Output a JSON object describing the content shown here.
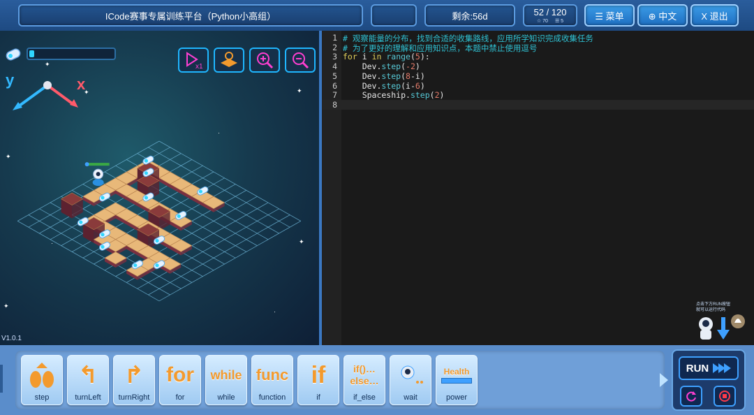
{
  "header": {
    "title": "ICode赛事专属训练平台（Python小高组）",
    "blank_box": "",
    "remaining": "剩余:56d",
    "progress": {
      "main": "52 / 120",
      "sub_left": "☆ 70",
      "sub_right": "☰ 5"
    },
    "menu_label": "☰ 菜单",
    "lang_label": "⊕ 中文",
    "exit_label": "X 退出"
  },
  "game": {
    "energy_level": 0.06,
    "axis_y": "y",
    "axis_x": "x",
    "version": "V1.0.1",
    "tools": [
      "speed-x1-icon",
      "map-icon",
      "zoom-in-icon",
      "zoom-out-icon"
    ],
    "helper_text_1": "点击下方RUN按钮",
    "helper_text_2": "就可以运行代码"
  },
  "editor": {
    "lines": [
      {
        "n": "1",
        "segments": [
          {
            "t": "# 观察能量的分布，找到合适的收集路线，应用所学知识完成收集任务",
            "c": "cm"
          }
        ]
      },
      {
        "n": "2",
        "segments": [
          {
            "t": "# 为了更好的理解和应用知识点，本题中禁止使用逗号",
            "c": "cm"
          }
        ]
      },
      {
        "n": "3",
        "segments": [
          {
            "t": "for",
            "c": "kw"
          },
          {
            "t": " i ",
            "c": ""
          },
          {
            "t": "in",
            "c": "kw"
          },
          {
            "t": " ",
            "c": ""
          },
          {
            "t": "range",
            "c": "fn"
          },
          {
            "t": "(",
            "c": ""
          },
          {
            "t": "5",
            "c": "num"
          },
          {
            "t": "):",
            "c": ""
          }
        ]
      },
      {
        "n": "4",
        "segments": [
          {
            "t": "    Dev.",
            "c": ""
          },
          {
            "t": "step",
            "c": "fn"
          },
          {
            "t": "(",
            "c": ""
          },
          {
            "t": "-2",
            "c": "num"
          },
          {
            "t": ")",
            "c": ""
          }
        ]
      },
      {
        "n": "5",
        "segments": [
          {
            "t": "    Dev.",
            "c": ""
          },
          {
            "t": "step",
            "c": "fn"
          },
          {
            "t": "(",
            "c": ""
          },
          {
            "t": "8",
            "c": "num"
          },
          {
            "t": "-i)",
            "c": ""
          }
        ]
      },
      {
        "n": "6",
        "segments": [
          {
            "t": "    Dev.",
            "c": ""
          },
          {
            "t": "step",
            "c": "fn"
          },
          {
            "t": "(i-",
            "c": ""
          },
          {
            "t": "6",
            "c": "num"
          },
          {
            "t": ")",
            "c": ""
          }
        ]
      },
      {
        "n": "7",
        "segments": [
          {
            "t": "    Spaceship.",
            "c": ""
          },
          {
            "t": "step",
            "c": "fn"
          },
          {
            "t": "(",
            "c": ""
          },
          {
            "t": "2",
            "c": "num"
          },
          {
            "t": ")",
            "c": ""
          }
        ]
      },
      {
        "n": "8",
        "segments": [
          {
            "t": "    ",
            "c": ""
          }
        ]
      }
    ]
  },
  "commands": [
    {
      "label": "step",
      "glyph": "step",
      "icon": "step-icon"
    },
    {
      "label": "turnLeft",
      "glyph": "↰",
      "icon": "turn-left-icon"
    },
    {
      "label": "turnRight",
      "glyph": "↱",
      "icon": "turn-right-icon"
    },
    {
      "label": "for",
      "glyph": "for",
      "icon": "for-icon"
    },
    {
      "label": "while",
      "glyph": "while",
      "icon": "while-icon"
    },
    {
      "label": "function",
      "glyph": "func",
      "icon": "function-icon"
    },
    {
      "label": "if",
      "glyph": "if",
      "icon": "if-icon"
    },
    {
      "label": "if_else",
      "glyph": "if()…\nelse…",
      "icon": "if-else-icon"
    },
    {
      "label": "wait",
      "glyph": "…",
      "icon": "wait-icon"
    },
    {
      "label": "power",
      "glyph": "Health",
      "icon": "power-icon"
    }
  ],
  "run": {
    "label": "RUN"
  },
  "colors": {
    "accent": "#3ea0ff",
    "energy": "#2fd6ff",
    "tile": "#e8b879",
    "block": "#8a3b3b"
  }
}
